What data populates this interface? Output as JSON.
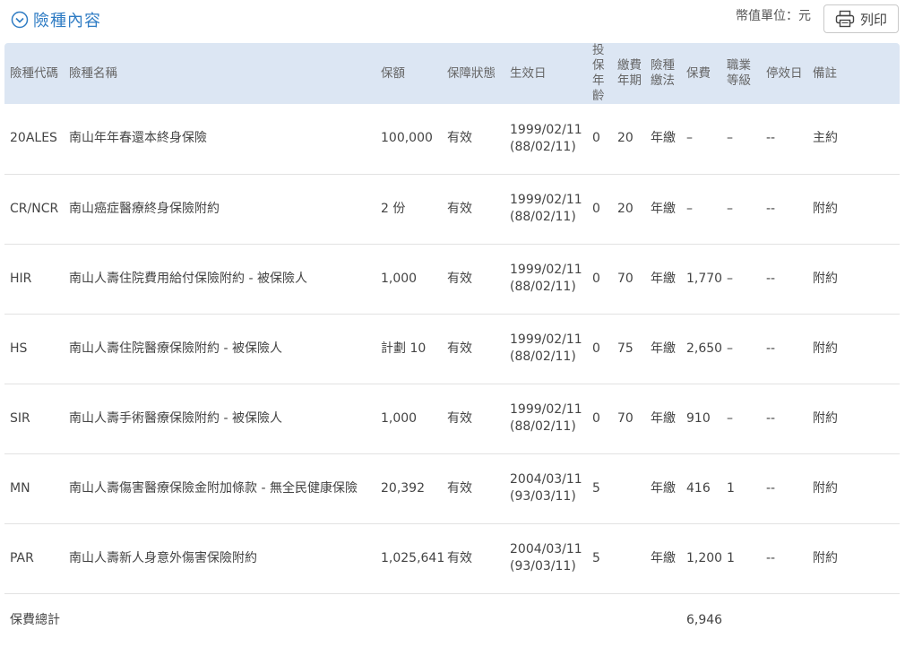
{
  "section": {
    "title": "險種內容",
    "icon": "chevron-down-circle-icon",
    "accent": "#2f7cc4"
  },
  "unit_label": "幣值單位：元",
  "print_label": "列印",
  "headers": {
    "code": "險種代碼",
    "name": "險種名稱",
    "amount": "保額",
    "status": "保障狀態",
    "effective": "生效日",
    "age_1": "投保",
    "age_2": "年齡",
    "term_1": "繳費",
    "term_2": "年期",
    "method_1": "險種",
    "method_2": "繳法",
    "premium": "保費",
    "job_1": "職業",
    "job_2": "等級",
    "stop": "停效日",
    "note": "備註"
  },
  "rows": [
    {
      "code": "20ALES",
      "name": "南山年年春還本終身保險",
      "amount": "100,000",
      "status": "有效",
      "date": "1999/02/11",
      "date_roc": "(88/02/11)",
      "age": "0",
      "term": "20",
      "method": "年繳",
      "premium": "–",
      "job": "–",
      "stop": "--",
      "note": "主約"
    },
    {
      "code": "CR/NCR",
      "name": "南山癌症醫療終身保險附約",
      "amount": "2 份",
      "status": "有效",
      "date": "1999/02/11",
      "date_roc": "(88/02/11)",
      "age": "0",
      "term": "20",
      "method": "年繳",
      "premium": "–",
      "job": "–",
      "stop": "--",
      "note": "附約"
    },
    {
      "code": "HIR",
      "name": "南山人壽住院費用給付保險附約 - 被保險人",
      "amount": "1,000",
      "status": "有效",
      "date": "1999/02/11",
      "date_roc": "(88/02/11)",
      "age": "0",
      "term": "70",
      "method": "年繳",
      "premium": "1,770",
      "job": "–",
      "stop": "--",
      "note": "附約"
    },
    {
      "code": "HS",
      "name": "南山人壽住院醫療保險附約 - 被保險人",
      "amount": "計劃 10",
      "status": "有效",
      "date": "1999/02/11",
      "date_roc": "(88/02/11)",
      "age": "0",
      "term": "75",
      "method": "年繳",
      "premium": "2,650",
      "job": "–",
      "stop": "--",
      "note": "附約"
    },
    {
      "code": "SIR",
      "name": "南山人壽手術醫療保險附約 - 被保險人",
      "amount": "1,000",
      "status": "有效",
      "date": "1999/02/11",
      "date_roc": "(88/02/11)",
      "age": "0",
      "term": "70",
      "method": "年繳",
      "premium": "910",
      "job": "–",
      "stop": "--",
      "note": "附約"
    },
    {
      "code": "MN",
      "name": "南山人壽傷害醫療保險金附加條款 - 無全民健康保險",
      "amount": "20,392",
      "status": "有效",
      "date": "2004/03/11",
      "date_roc": "(93/03/11)",
      "age": "5",
      "term": "",
      "method": "年繳",
      "premium": "416",
      "job": "1",
      "stop": "--",
      "note": "附約"
    },
    {
      "code": "PAR",
      "name": "南山人壽新人身意外傷害保險附約",
      "amount": "1,025,641",
      "status": "有效",
      "date": "2004/03/11",
      "date_roc": "(93/03/11)",
      "age": "5",
      "term": "",
      "method": "年繳",
      "premium": "1,200",
      "job": "1",
      "stop": "--",
      "note": "附約"
    }
  ],
  "total": {
    "label": "保費總計",
    "value": "6,946"
  }
}
